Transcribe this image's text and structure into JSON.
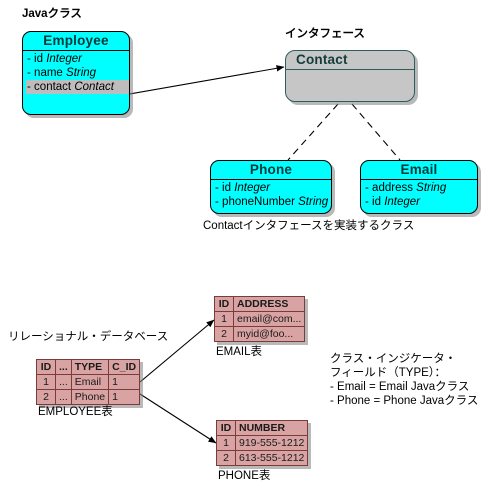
{
  "diagram": {
    "title": "Java class to relational database mapping diagram"
  },
  "labels": {
    "java_class": "Javaクラス",
    "interface": "インタフェース",
    "implements_caption": "Contactインタフェースを実装するクラス",
    "relational_db": "リレーショナル・データベース",
    "employee_table_caption": "EMPLOYEE表",
    "email_table_caption": "EMAIL表",
    "phone_table_caption": "PHONE表"
  },
  "classes": {
    "employee": {
      "name": "Employee",
      "attributes": [
        {
          "visibility": "-",
          "name": "id",
          "type": "Integer",
          "highlighted": false
        },
        {
          "visibility": "-",
          "name": "name",
          "type": "String",
          "highlighted": false
        },
        {
          "visibility": "-",
          "name": "contact",
          "type": "Contact",
          "highlighted": true
        }
      ]
    },
    "contact": {
      "name": "Contact",
      "attributes": []
    },
    "phone": {
      "name": "Phone",
      "attributes": [
        {
          "visibility": "-",
          "name": "id",
          "type": "Integer",
          "highlighted": false
        },
        {
          "visibility": "-",
          "name": "phoneNumber",
          "type": "String",
          "highlighted": false
        }
      ]
    },
    "email": {
      "name": "Email",
      "attributes": [
        {
          "visibility": "-",
          "name": "address",
          "type": "String",
          "highlighted": false
        },
        {
          "visibility": "-",
          "name": "id",
          "type": "Integer",
          "highlighted": false
        }
      ]
    }
  },
  "tables": {
    "employee": {
      "headers": [
        "ID",
        "...",
        "TYPE",
        "C_ID"
      ],
      "rows": [
        [
          "1",
          "...",
          "Email",
          "1"
        ],
        [
          "2",
          "...",
          "Phone",
          "1"
        ]
      ]
    },
    "email": {
      "headers": [
        "ID",
        "ADDRESS"
      ],
      "rows": [
        [
          "1",
          "email@com..."
        ],
        [
          "2",
          "myid@foo..."
        ]
      ]
    },
    "phone": {
      "headers": [
        "ID",
        "NUMBER"
      ],
      "rows": [
        [
          "1",
          "919-555-1212"
        ],
        [
          "2",
          "613-555-1212"
        ]
      ]
    }
  },
  "note": {
    "line1": "クラス・インジケータ・",
    "line2": "フィールド（TYPE）：",
    "line3": "- Email = Email Javaクラス",
    "line4": "- Phone = Phone Javaクラス"
  },
  "colors": {
    "class_fill": "#00ffff",
    "interface_fill": "#c6c6c6",
    "table_fill": "#d9a3a3",
    "highlight_fill": "#bdbdbd",
    "line": "#000000"
  }
}
